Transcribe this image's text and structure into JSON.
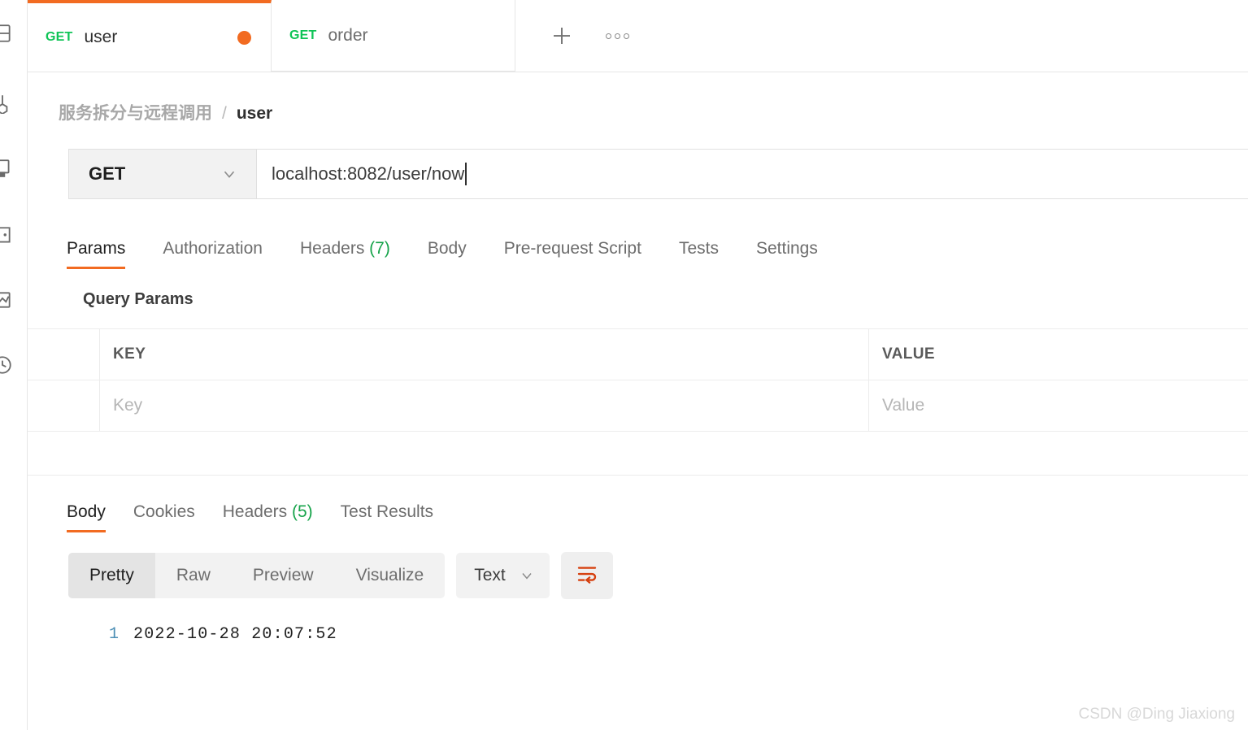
{
  "sidebar": {
    "items": [
      {
        "name": "collections-icon",
        "label": "Collections"
      },
      {
        "name": "apis-icon",
        "label": "APIs"
      },
      {
        "name": "environments-icon",
        "label": "Environments"
      },
      {
        "name": "mock-servers-icon",
        "label": "Mock Servers"
      },
      {
        "name": "monitors-icon",
        "label": "Monitors"
      },
      {
        "name": "history-icon",
        "label": "History"
      }
    ]
  },
  "tabs": {
    "items": [
      {
        "method": "GET",
        "name": "user",
        "active": true,
        "unsaved": true
      },
      {
        "method": "GET",
        "name": "order",
        "active": false,
        "unsaved": false
      }
    ],
    "new_tab_label": "+",
    "more_label": "More"
  },
  "breadcrumb": {
    "parent": "服务拆分与远程调用",
    "separator": "/",
    "current": "user"
  },
  "request": {
    "method": "GET",
    "url": "localhost:8082/user/now",
    "tabs": [
      {
        "label": "Params",
        "count": "",
        "active": true
      },
      {
        "label": "Authorization",
        "count": "",
        "active": false
      },
      {
        "label": "Headers",
        "count": "(7)",
        "active": false
      },
      {
        "label": "Body",
        "count": "",
        "active": false
      },
      {
        "label": "Pre-request Script",
        "count": "",
        "active": false
      },
      {
        "label": "Tests",
        "count": "",
        "active": false
      },
      {
        "label": "Settings",
        "count": "",
        "active": false
      }
    ]
  },
  "query_params": {
    "title": "Query Params",
    "headers": {
      "key": "KEY",
      "value": "VALUE"
    },
    "rows": [
      {
        "key_placeholder": "Key",
        "value_placeholder": "Value"
      }
    ]
  },
  "response": {
    "tabs": [
      {
        "label": "Body",
        "count": "",
        "active": true
      },
      {
        "label": "Cookies",
        "count": "",
        "active": false
      },
      {
        "label": "Headers",
        "count": "(5)",
        "active": false
      },
      {
        "label": "Test Results",
        "count": "",
        "active": false
      }
    ],
    "view_modes": [
      {
        "label": "Pretty",
        "active": true
      },
      {
        "label": "Raw",
        "active": false
      },
      {
        "label": "Preview",
        "active": false
      },
      {
        "label": "Visualize",
        "active": false
      }
    ],
    "format": "Text",
    "wrap_button": "word-wrap-icon",
    "body_lines": [
      {
        "number": "1",
        "text": "2022-10-28 20:07:52"
      }
    ]
  },
  "watermark": "CSDN @Ding Jiaxiong",
  "colors": {
    "accent": "#f26b21",
    "method_get": "#10c457",
    "count_green": "#16a34a",
    "line_number": "#4d8fb5"
  }
}
